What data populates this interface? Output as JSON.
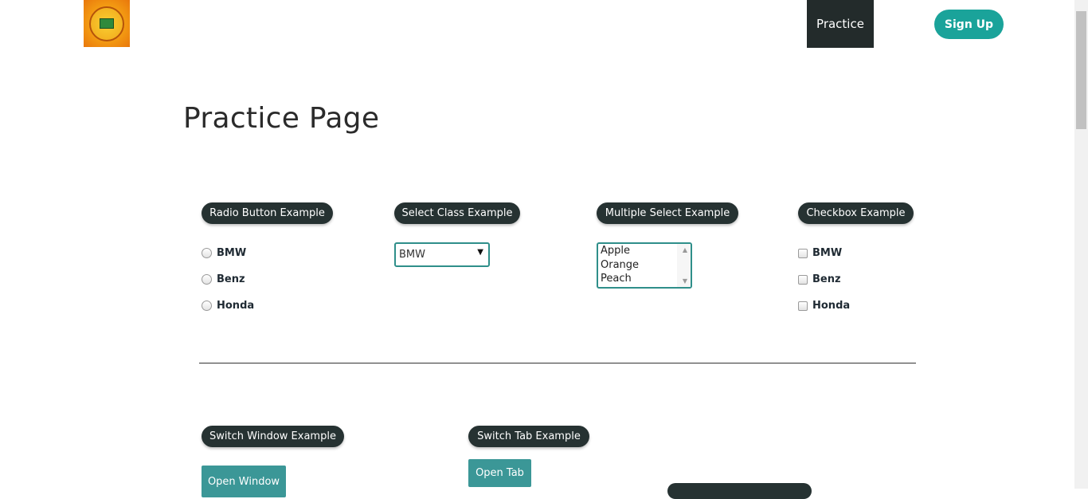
{
  "header": {
    "nav_practice": "Practice",
    "signup_label": "Sign Up"
  },
  "page": {
    "title": "Practice Page"
  },
  "radio_section": {
    "heading": "Radio Button Example",
    "options": [
      "BMW",
      "Benz",
      "Honda"
    ]
  },
  "select_section": {
    "heading": "Select Class Example",
    "selected": "BMW"
  },
  "multi_select_section": {
    "heading": "Multiple Select Example",
    "options": [
      "Apple",
      "Orange",
      "Peach"
    ]
  },
  "checkbox_section": {
    "heading": "Checkbox Example",
    "options": [
      "BMW",
      "Benz",
      "Honda"
    ]
  },
  "switch_window_section": {
    "heading": "Switch Window Example",
    "button_label": "Open Window"
  },
  "switch_tab_section": {
    "heading": "Switch Tab Example",
    "button_label": "Open Tab"
  },
  "colors": {
    "dark_pill": "#263232",
    "accent_teal": "#1aa39a",
    "button_teal": "#3b9797"
  }
}
